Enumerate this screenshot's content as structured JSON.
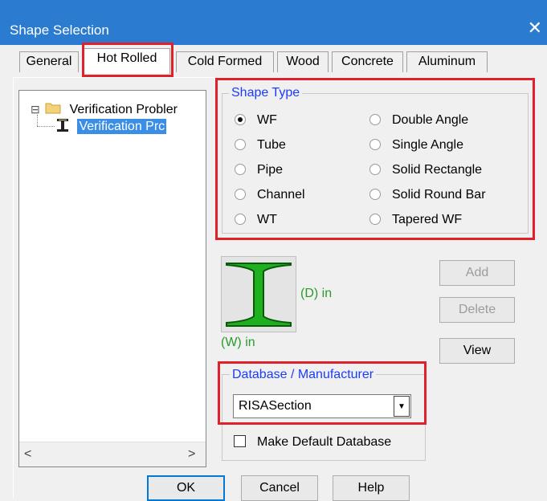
{
  "window": {
    "title": "Shape Selection",
    "close_glyph": "✕"
  },
  "tabs": [
    {
      "label": "General"
    },
    {
      "label": "Hot Rolled",
      "active": true
    },
    {
      "label": "Cold Formed"
    },
    {
      "label": "Wood"
    },
    {
      "label": "Concrete"
    },
    {
      "label": "Aluminum"
    }
  ],
  "tree": {
    "root_label": "Verification Probler",
    "child_label": "Verification Prc",
    "root_toggle": "⊟",
    "scroll_left": "<",
    "scroll_right": ">"
  },
  "shape_type": {
    "legend": "Shape Type",
    "options_left": [
      "WF",
      "Tube",
      "Pipe",
      "Channel",
      "WT"
    ],
    "options_right": [
      "Double Angle",
      "Single Angle",
      "Solid Rectangle",
      "Solid Round Bar",
      "Tapered WF"
    ],
    "selected": "WF"
  },
  "preview": {
    "depth_label": "(D) in",
    "width_label": "(W) in",
    "shape_color": "#1fb01f"
  },
  "buttons": {
    "add": "Add",
    "delete": "Delete",
    "view": "View",
    "ok": "OK",
    "cancel": "Cancel",
    "help": "Help"
  },
  "database": {
    "legend": "Database / Manufacturer",
    "selected": "RISASection",
    "make_default_label": "Make Default Database",
    "make_default_checked": false
  },
  "colors": {
    "title_bar": "#2b7cd0",
    "highlight_box": "#e0202a",
    "legend_text": "#1a3cff",
    "dim_text": "#2a9a2a"
  }
}
